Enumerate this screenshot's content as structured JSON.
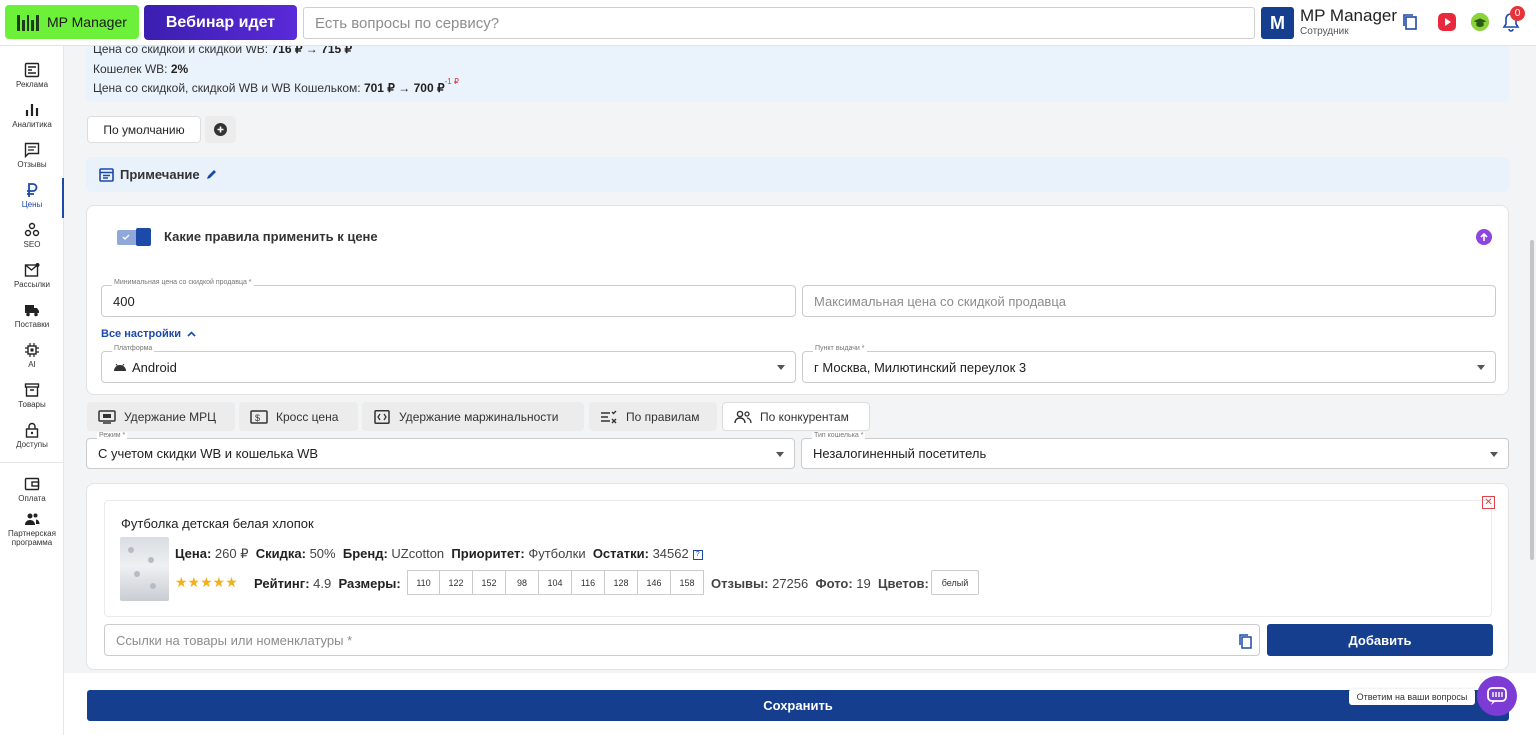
{
  "header": {
    "logo_label": "MP Manager",
    "webinar_label": "Вебинар идет",
    "search_placeholder": "Есть вопросы по сервису?",
    "avatar_letter": "M",
    "user_name": "MP Manager",
    "user_role": "Сотрудник",
    "notifications_count": "0"
  },
  "sidebar": {
    "items": [
      {
        "label": "Реклама",
        "icon": "ads-icon"
      },
      {
        "label": "Аналитика",
        "icon": "analytics-icon"
      },
      {
        "label": "Отзывы",
        "icon": "reviews-icon"
      },
      {
        "label": "Цены",
        "icon": "ruble-icon"
      },
      {
        "label": "SEO",
        "icon": "seo-icon"
      },
      {
        "label": "Рассылки",
        "icon": "mail-icon"
      },
      {
        "label": "Поставки",
        "icon": "truck-icon"
      },
      {
        "label": "AI",
        "icon": "chip-icon"
      },
      {
        "label": "Товары",
        "icon": "box-icon"
      },
      {
        "label": "Доступы",
        "icon": "lock-icon"
      },
      {
        "label": "Оплата",
        "icon": "wallet-icon"
      },
      {
        "label": "Партнерская программа",
        "icon": "partners-icon"
      }
    ]
  },
  "info": {
    "line1_label": "Цена со скидкой и скидкой WB:",
    "line1_value": "716 ₽ → 715 ₽",
    "line2_label": "Кошелек WB:",
    "line2_value": "2%",
    "line3_label": "Цена со скидкой, скидкой WB и WB Кошельком:",
    "line3_value": "701 ₽ → 700 ₽",
    "line3_sup": "-1 ₽"
  },
  "preset": {
    "label": "По умолчанию"
  },
  "note": {
    "label": "Примечание"
  },
  "rules": {
    "title": "Какие правила применить к цене",
    "min_label": "Минимальная цена со скидкой продавца *",
    "min_value": "400",
    "max_placeholder": "Максимальная цена со скидкой продавца",
    "all_settings": "Все настройки",
    "platform_label": "Платформа",
    "platform_value": "Android",
    "pickup_label": "Пункт выдачи *",
    "pickup_value": "г Москва, Милютинский переулок 3"
  },
  "tabs": [
    {
      "label": "Удержание МРЦ",
      "icon": "monitor-icon"
    },
    {
      "label": "Кросс цена",
      "icon": "dollar-card-icon"
    },
    {
      "label": "Удержание маржинальности",
      "icon": "code-icon"
    },
    {
      "label": "По правилам",
      "icon": "rules-list-icon"
    },
    {
      "label": "По конкурентам",
      "icon": "competitors-icon"
    }
  ],
  "mode": {
    "label": "Режим *",
    "value": "С учетом скидки WB и кошелька WB",
    "wallet_label": "Тип кошелька *",
    "wallet_value": "Незалогиненный посетитель"
  },
  "product": {
    "title": "Футболка детская белая хлопок",
    "price_label": "Цена:",
    "price_value": "260 ₽",
    "discount_label": "Скидка:",
    "discount_value": "50%",
    "brand_label": "Бренд:",
    "brand_value": "UZcotton",
    "priority_label": "Приоритет:",
    "priority_value": "Футболки",
    "stock_label": "Остатки:",
    "stock_value": "34562",
    "stars": "★★★★★",
    "rating_label": "Рейтинг:",
    "rating_value": "4.9",
    "sizes_label": "Размеры:",
    "sizes": [
      "110",
      "122",
      "152",
      "98",
      "104",
      "116",
      "128",
      "146",
      "158"
    ],
    "reviews_label": "Отзывы:",
    "reviews_value": "27256",
    "photo_label": "Фото:",
    "photo_value": "19",
    "colors_label": "Цветов:",
    "color_value": "белый"
  },
  "links": {
    "placeholder": "Ссылки на товары или номенклатуры *",
    "add_label": "Добавить"
  },
  "footer": {
    "save_label": "Сохранить",
    "chat_tip": "Ответим на ваши вопросы"
  },
  "colors": {
    "primary": "#153f8e",
    "accent_green": "#6cf03a",
    "purple": "#7d3bd6"
  }
}
